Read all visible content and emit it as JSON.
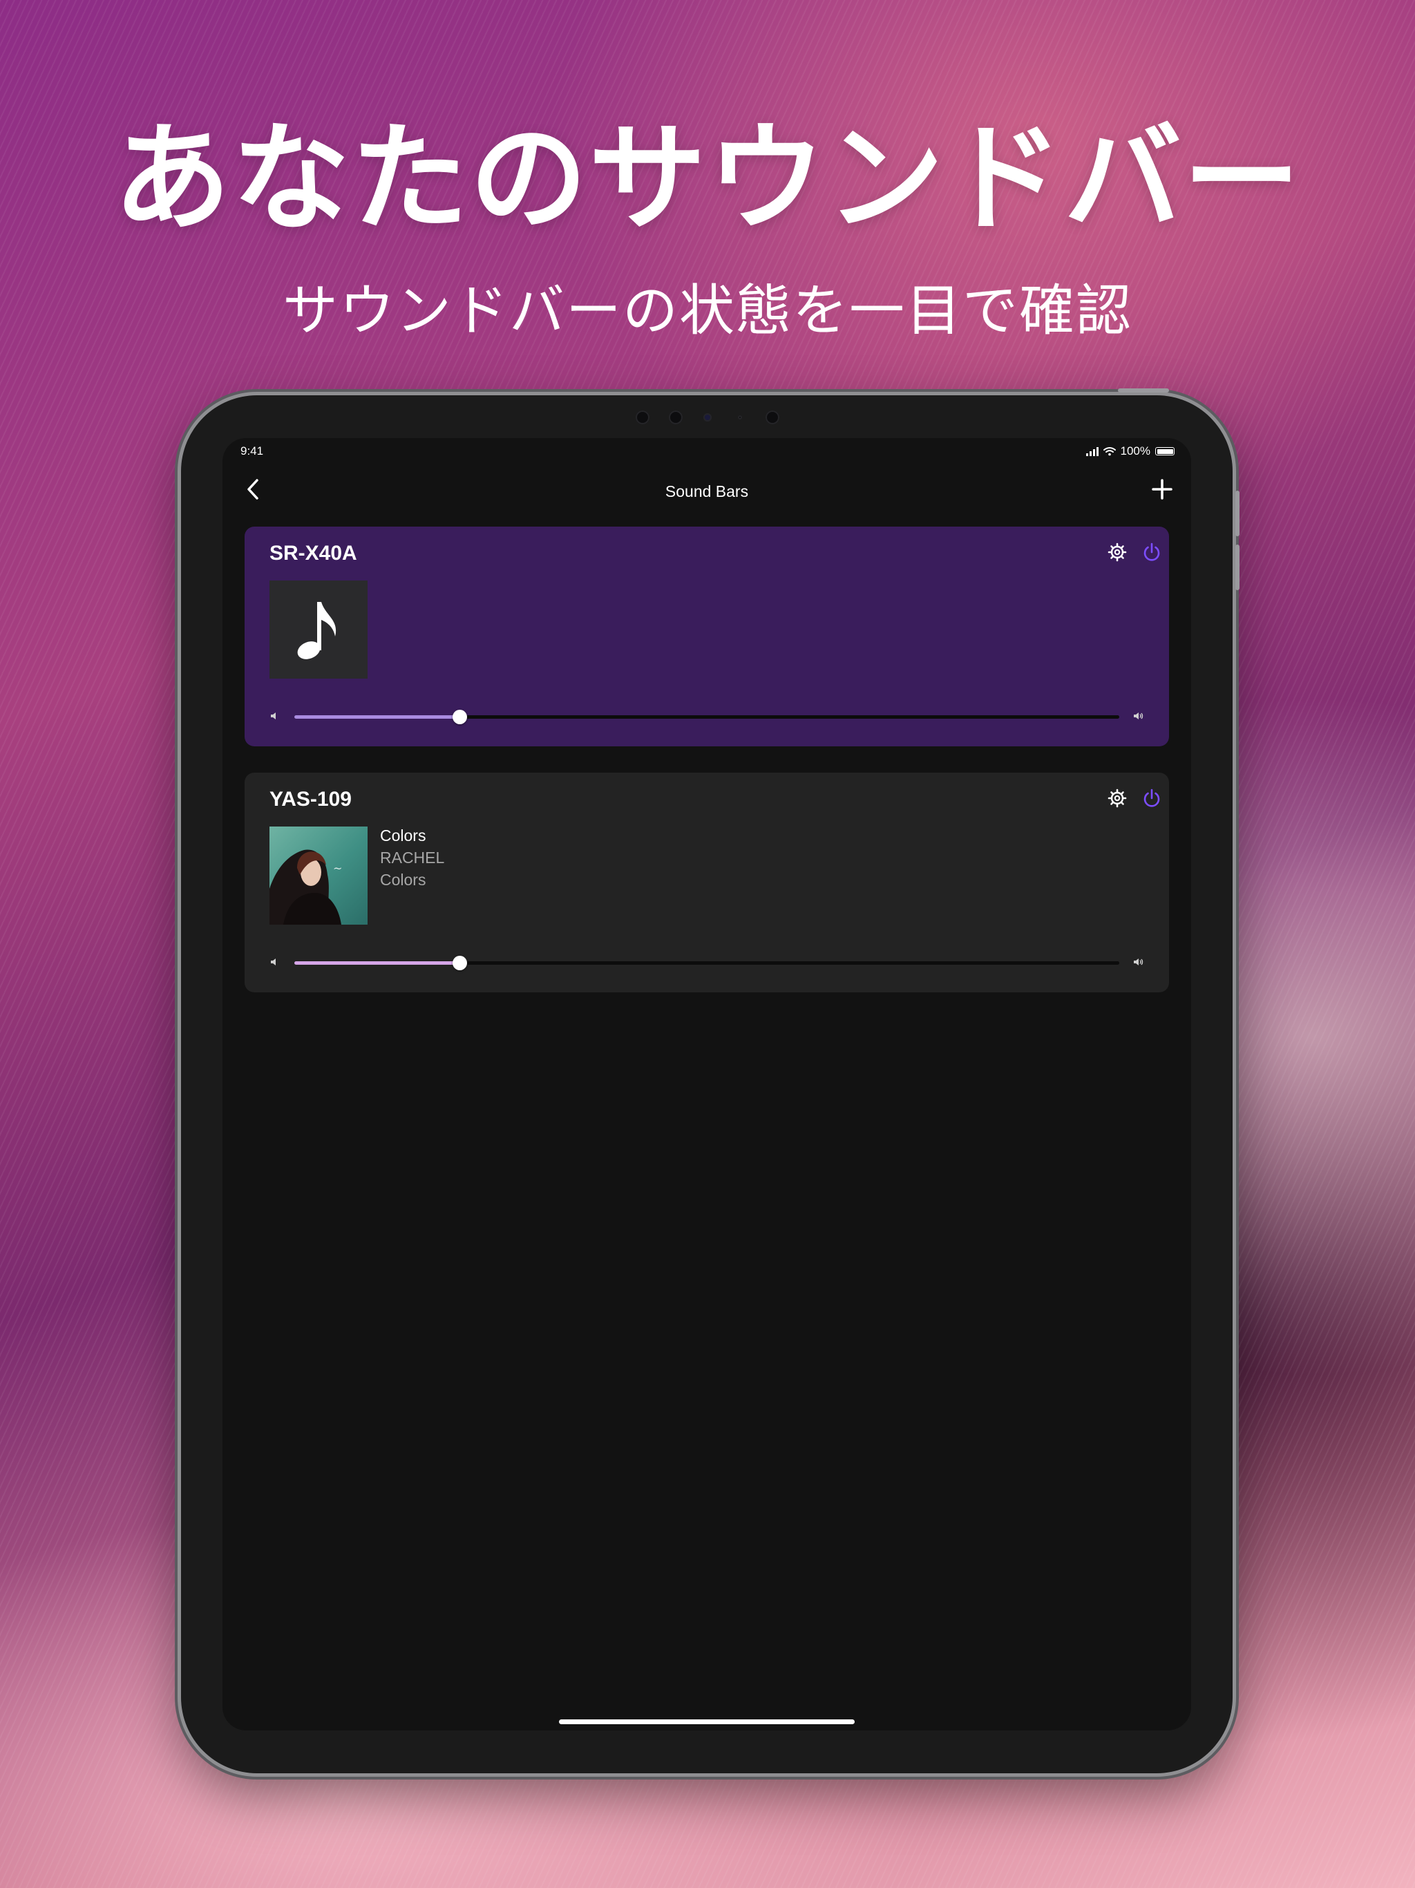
{
  "promo": {
    "headline": "あなたのサウンドバー",
    "subheadline": "サウンドバーの状態を一目で確認"
  },
  "status_bar": {
    "time": "9:41",
    "battery": "100%",
    "signal_icon": "cellular-signal-icon",
    "wifi_icon": "wifi-icon",
    "battery_icon": "battery-icon"
  },
  "nav": {
    "title": "Sound Bars",
    "back_icon": "chevron-left-icon",
    "add_icon": "plus-icon"
  },
  "devices": [
    {
      "name": "SR-X40A",
      "card_color": "#3a1d5c",
      "artwork_icon": "music-note-icon",
      "settings_icon": "gear-icon",
      "power_icon": "power-icon",
      "volume": 0.2,
      "slider_fill_color": "#a98be0"
    },
    {
      "name": "YAS-109",
      "card_color": "#232323",
      "track_title": "Colors",
      "track_artist": "RACHEL",
      "track_album": "Colors",
      "artwork_icon": "album-art",
      "settings_icon": "gear-icon",
      "power_icon": "power-icon",
      "volume": 0.2,
      "slider_fill_color": "#d6a6e8"
    }
  ],
  "accent_color": "#7c4dff"
}
